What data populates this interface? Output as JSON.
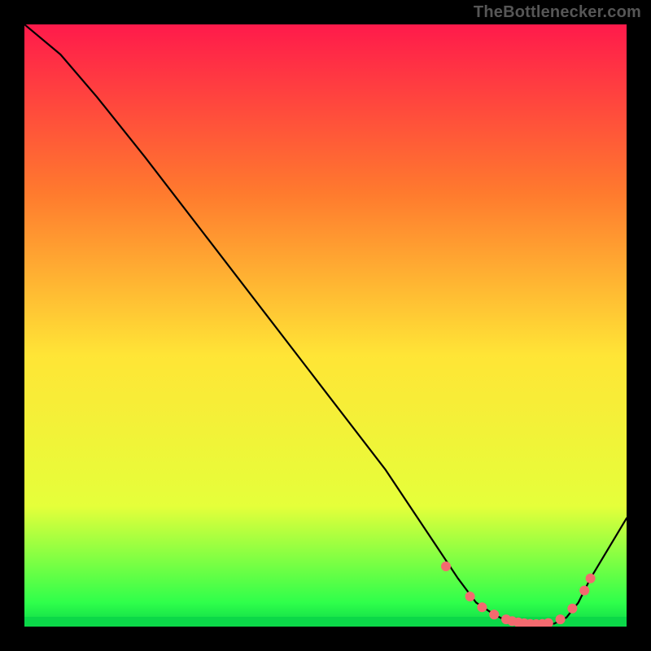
{
  "attribution": "TheBottlenecker.com",
  "chart_data": {
    "type": "line",
    "title": "",
    "xlabel": "",
    "ylabel": "",
    "xlim": [
      0,
      100
    ],
    "ylim": [
      0,
      100
    ],
    "grid": false,
    "legend": "none",
    "background_gradient": {
      "top": "#ff1a4b",
      "q1": "#ff7a2e",
      "mid": "#ffe536",
      "q3": "#e5ff3a",
      "green_band": "#2fff4b",
      "bottom_band": "#0bd848"
    },
    "series": [
      {
        "name": "bottleneck-curve",
        "type": "line",
        "stroke": "#000000",
        "x": [
          0,
          6,
          12,
          20,
          30,
          40,
          50,
          60,
          68,
          72,
          75,
          78,
          80,
          82,
          84,
          86,
          88,
          90,
          92,
          94,
          100
        ],
        "y": [
          100,
          95,
          88,
          78,
          65,
          52,
          39,
          26,
          14,
          8,
          4,
          2,
          1,
          0.5,
          0.3,
          0.3,
          0.5,
          1.5,
          4,
          8,
          18
        ]
      },
      {
        "name": "optimal-markers",
        "type": "scatter",
        "stroke": "#f36a6f",
        "x": [
          70,
          74,
          76,
          78,
          80,
          81,
          82,
          83,
          84,
          85,
          86,
          87,
          89,
          91,
          93,
          94
        ],
        "y": [
          10,
          5,
          3.2,
          2,
          1.2,
          0.9,
          0.7,
          0.55,
          0.45,
          0.4,
          0.45,
          0.6,
          1.2,
          3.0,
          6.0,
          8.0
        ]
      }
    ]
  }
}
